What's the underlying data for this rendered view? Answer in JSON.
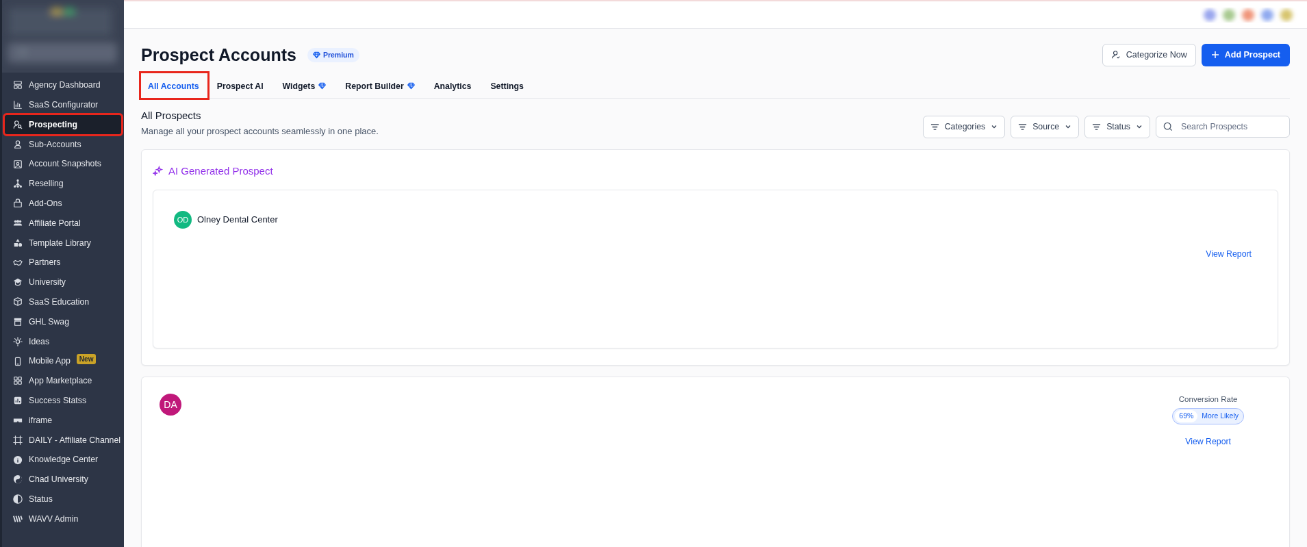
{
  "sidebar": {
    "items": [
      {
        "label": "Agency Dashboard",
        "selected": false
      },
      {
        "label": "SaaS Configurator",
        "selected": false
      },
      {
        "label": "Prospecting",
        "selected": true,
        "annotated": true
      },
      {
        "label": "Sub-Accounts",
        "selected": false
      },
      {
        "label": "Account Snapshots",
        "selected": false
      },
      {
        "label": "Reselling",
        "selected": false
      },
      {
        "label": "Add-Ons",
        "selected": false
      },
      {
        "label": "Affiliate Portal",
        "selected": false
      },
      {
        "label": "Template Library",
        "selected": false
      },
      {
        "label": "Partners",
        "selected": false
      },
      {
        "label": "University",
        "selected": false
      },
      {
        "label": "SaaS Education",
        "selected": false
      },
      {
        "label": "GHL Swag",
        "selected": false
      },
      {
        "label": "Ideas",
        "selected": false
      },
      {
        "label": "Mobile App",
        "selected": false,
        "badge": "New"
      },
      {
        "label": "App Marketplace",
        "selected": false
      },
      {
        "label": "Success Statss",
        "selected": false
      },
      {
        "label": "iframe",
        "selected": false
      },
      {
        "label": "DAILY - Affiliate Channel",
        "selected": false
      },
      {
        "label": "Knowledge Center",
        "selected": false
      },
      {
        "label": "Chad University",
        "selected": false
      },
      {
        "label": "Status",
        "selected": false
      },
      {
        "label": "WAVV Admin",
        "selected": false
      }
    ]
  },
  "page": {
    "title": "Prospect Accounts",
    "badge": "Premium",
    "buttons": [
      {
        "label": "Categorize Now",
        "kind": "outline"
      },
      {
        "label": "Add Prospect",
        "kind": "primary"
      }
    ],
    "tabs": [
      {
        "label": "All Accounts",
        "selected": true,
        "annotated": true
      },
      {
        "label": "Prospect AI",
        "selected": false
      },
      {
        "label": "Widgets",
        "selected": false,
        "premium": true
      },
      {
        "label": "Report Builder",
        "selected": false,
        "premium": true
      },
      {
        "label": "Analytics",
        "selected": false
      },
      {
        "label": "Settings",
        "selected": false
      }
    ]
  },
  "section": {
    "title": "All Prospects",
    "subtitle": "Manage all your prospect accounts seamlessly in one place.",
    "filters": [
      "Categories",
      "Source",
      "Status"
    ],
    "search": {
      "placeholder": "Search Prospects"
    }
  },
  "ai_card": {
    "title": "AI Generated Prospect",
    "prospect": {
      "initials": "OD",
      "name": "Olney Dental Center",
      "color": "#12b981",
      "link": "View Report"
    }
  },
  "prospect_card": {
    "initials": "DA",
    "color": "#c0187a",
    "metric_label": "Conversion Rate",
    "metric_value": "69%",
    "metric_text": "More Likely",
    "link": "View Report"
  }
}
